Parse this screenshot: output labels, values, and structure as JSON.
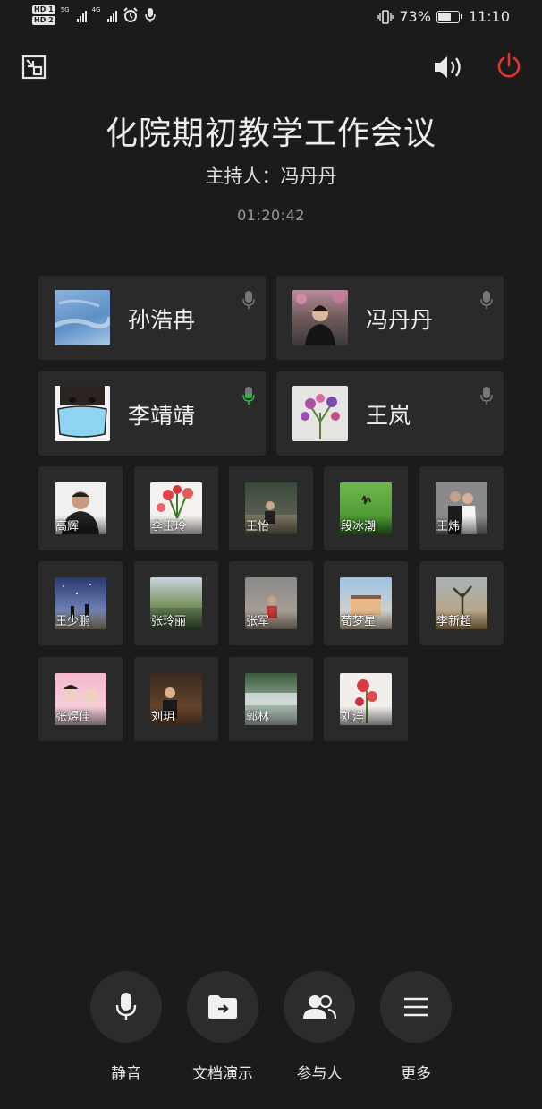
{
  "status_bar": {
    "hd1": "HD 1",
    "hd2": "HD 2",
    "net1": "5G",
    "net2": "4G",
    "battery_percent": "73%",
    "battery_level": 0.73,
    "time": "11:10",
    "icons": [
      "signal-icon",
      "alarm-icon",
      "mic-icon",
      "vibrate-icon",
      "battery-icon"
    ]
  },
  "top_bar": {
    "icons": [
      "minimize-window-icon",
      "speaker-icon",
      "power-icon"
    ],
    "power_color": "#e3352d"
  },
  "meeting": {
    "title": "化院期初教学工作会议",
    "host": "主持人：冯丹丹",
    "elapsed": "01:20:42"
  },
  "featured": [
    {
      "name": "孙浩冉",
      "mic_active": false
    },
    {
      "name": "冯丹丹",
      "mic_active": false
    },
    {
      "name": "李靖靖",
      "mic_active": true
    },
    {
      "name": "王岚",
      "mic_active": false
    }
  ],
  "participants": [
    "高辉",
    "李玉玲",
    "王怡",
    "段冰潮",
    "王炜",
    "王少鹏",
    "张玲丽",
    "张军",
    "荀梦星",
    "李新超",
    "张煜佳",
    "刘玥",
    "郭林",
    "刘洋"
  ],
  "controls": [
    {
      "label": "静音",
      "icon": "microphone-icon"
    },
    {
      "label": "文档演示",
      "icon": "share-document-icon"
    },
    {
      "label": "参与人",
      "icon": "participants-icon"
    },
    {
      "label": "更多",
      "icon": "more-menu-icon"
    }
  ],
  "colors": {
    "background": "#1b1b1c",
    "tile": "#2a2a2b",
    "mic_active": "#2fb84a"
  }
}
